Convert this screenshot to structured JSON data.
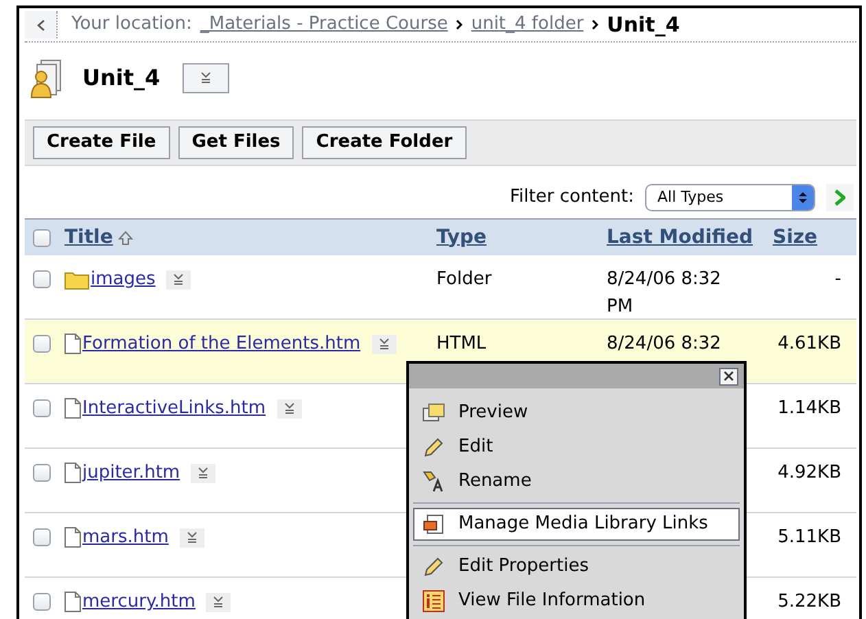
{
  "breadcrumb": {
    "label": "Your location:",
    "links": [
      "_Materials - Practice Course",
      "unit_4 folder"
    ],
    "current": "Unit_4"
  },
  "folder_title": "Unit_4",
  "toolbar": {
    "buttons": [
      "Create File",
      "Get Files",
      "Create Folder"
    ]
  },
  "filter": {
    "label": "Filter content:",
    "value": "All Types"
  },
  "table": {
    "select_all_checked": false,
    "columns": [
      "Title",
      "Type",
      "Last Modified",
      "Size"
    ],
    "rows": [
      {
        "kind": "folder",
        "title": "images",
        "type": "Folder",
        "modified": "8/24/06 8:32 PM",
        "size": "-",
        "highlighted": false,
        "checked": false
      },
      {
        "kind": "file",
        "title": "Formation of the Elements.htm",
        "type": "HTML",
        "modified": "8/24/06 8:32",
        "size": "4.61KB",
        "highlighted": true,
        "checked": false
      },
      {
        "kind": "file",
        "title": "InteractiveLinks.htm",
        "size": "1.14KB",
        "highlighted": false,
        "checked": false
      },
      {
        "kind": "file",
        "title": "jupiter.htm",
        "size": "4.92KB",
        "highlighted": false,
        "checked": false
      },
      {
        "kind": "file",
        "title": "mars.htm",
        "size": "5.11KB",
        "highlighted": false,
        "checked": false
      },
      {
        "kind": "file",
        "title": "mercury.htm",
        "size": "5.22KB",
        "highlighted": false,
        "checked": false
      }
    ]
  },
  "context_menu": {
    "items": [
      {
        "kind": "preview",
        "label": "Preview",
        "selected": false
      },
      {
        "kind": "edit",
        "label": "Edit",
        "selected": false
      },
      {
        "kind": "rename",
        "label": "Rename",
        "selected": false
      },
      {
        "kind": "media",
        "label": "Manage Media Library Links",
        "selected": true
      },
      {
        "kind": "edit",
        "label": "Edit Properties",
        "selected": false
      },
      {
        "kind": "info",
        "label": "View File Information",
        "selected": false
      }
    ]
  }
}
